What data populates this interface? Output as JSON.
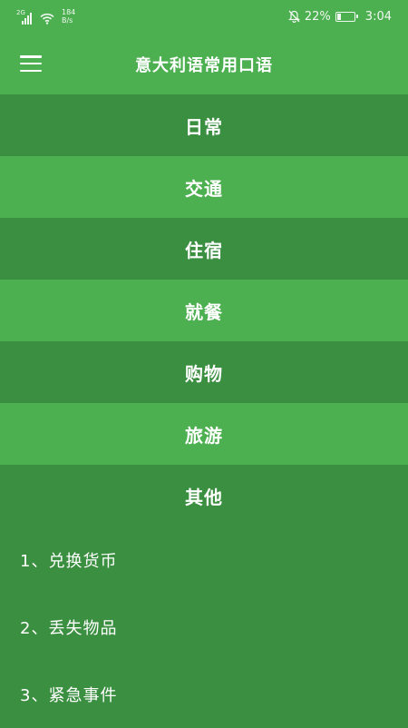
{
  "status_bar": {
    "network": "2G",
    "speed_value": "184",
    "speed_unit": "B/s",
    "battery_percent": "22%",
    "battery_level": 0.22,
    "time": "3:04"
  },
  "app_bar": {
    "title": "意大利语常用口语"
  },
  "categories": [
    {
      "label": "日常"
    },
    {
      "label": "交通"
    },
    {
      "label": "住宿"
    },
    {
      "label": "就餐"
    },
    {
      "label": "购物"
    },
    {
      "label": "旅游"
    },
    {
      "label": "其他"
    }
  ],
  "sub_items": [
    {
      "label": "1、兑换货币"
    },
    {
      "label": "2、丢失物品"
    },
    {
      "label": "3、紧急事件"
    }
  ],
  "colors": {
    "primary": "#4caf50",
    "primary_dark": "#3b8f40",
    "text": "#ffffff"
  }
}
